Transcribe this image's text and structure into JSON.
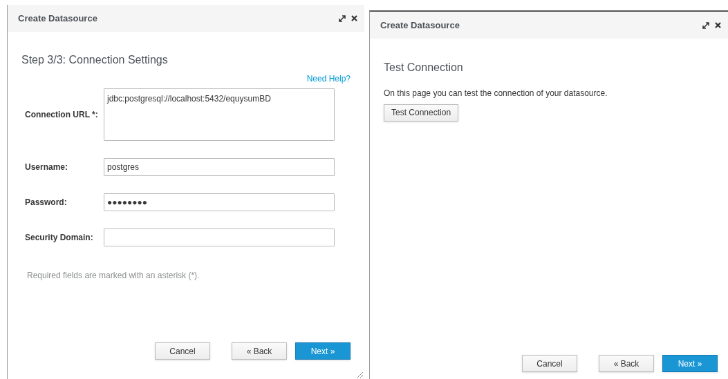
{
  "dialogs": [
    {
      "title": "Create Datasource",
      "heading": "Step 3/3: Connection Settings",
      "help_link": "Need Help?",
      "fields": [
        {
          "kind": "textarea",
          "label": "Connection URL *:",
          "value": "jdbc:postgresql://localhost:5432/equysumBD"
        },
        {
          "kind": "input",
          "label": "Username:",
          "value": "postgres"
        },
        {
          "kind": "input",
          "label": "Password:",
          "value": "●●●●●●●●"
        },
        {
          "kind": "input",
          "label": "Security Domain:"
        }
      ],
      "note": "Required fields are marked with an asterisk (*).",
      "buttons": [
        {
          "label": "Cancel",
          "kind": "default"
        },
        {
          "label": "« Back",
          "kind": "default"
        },
        {
          "label": "Next »",
          "kind": "primary"
        }
      ]
    },
    {
      "title": "Create Datasource",
      "heading": "Test Connection",
      "text": "On this page you can test the connection of your datasource.",
      "action": "Test Connection",
      "buttons": [
        {
          "label": "Cancel",
          "kind": "default"
        },
        {
          "label": "« Back",
          "kind": "default"
        },
        {
          "label": "Next »",
          "kind": "primary"
        }
      ]
    }
  ]
}
